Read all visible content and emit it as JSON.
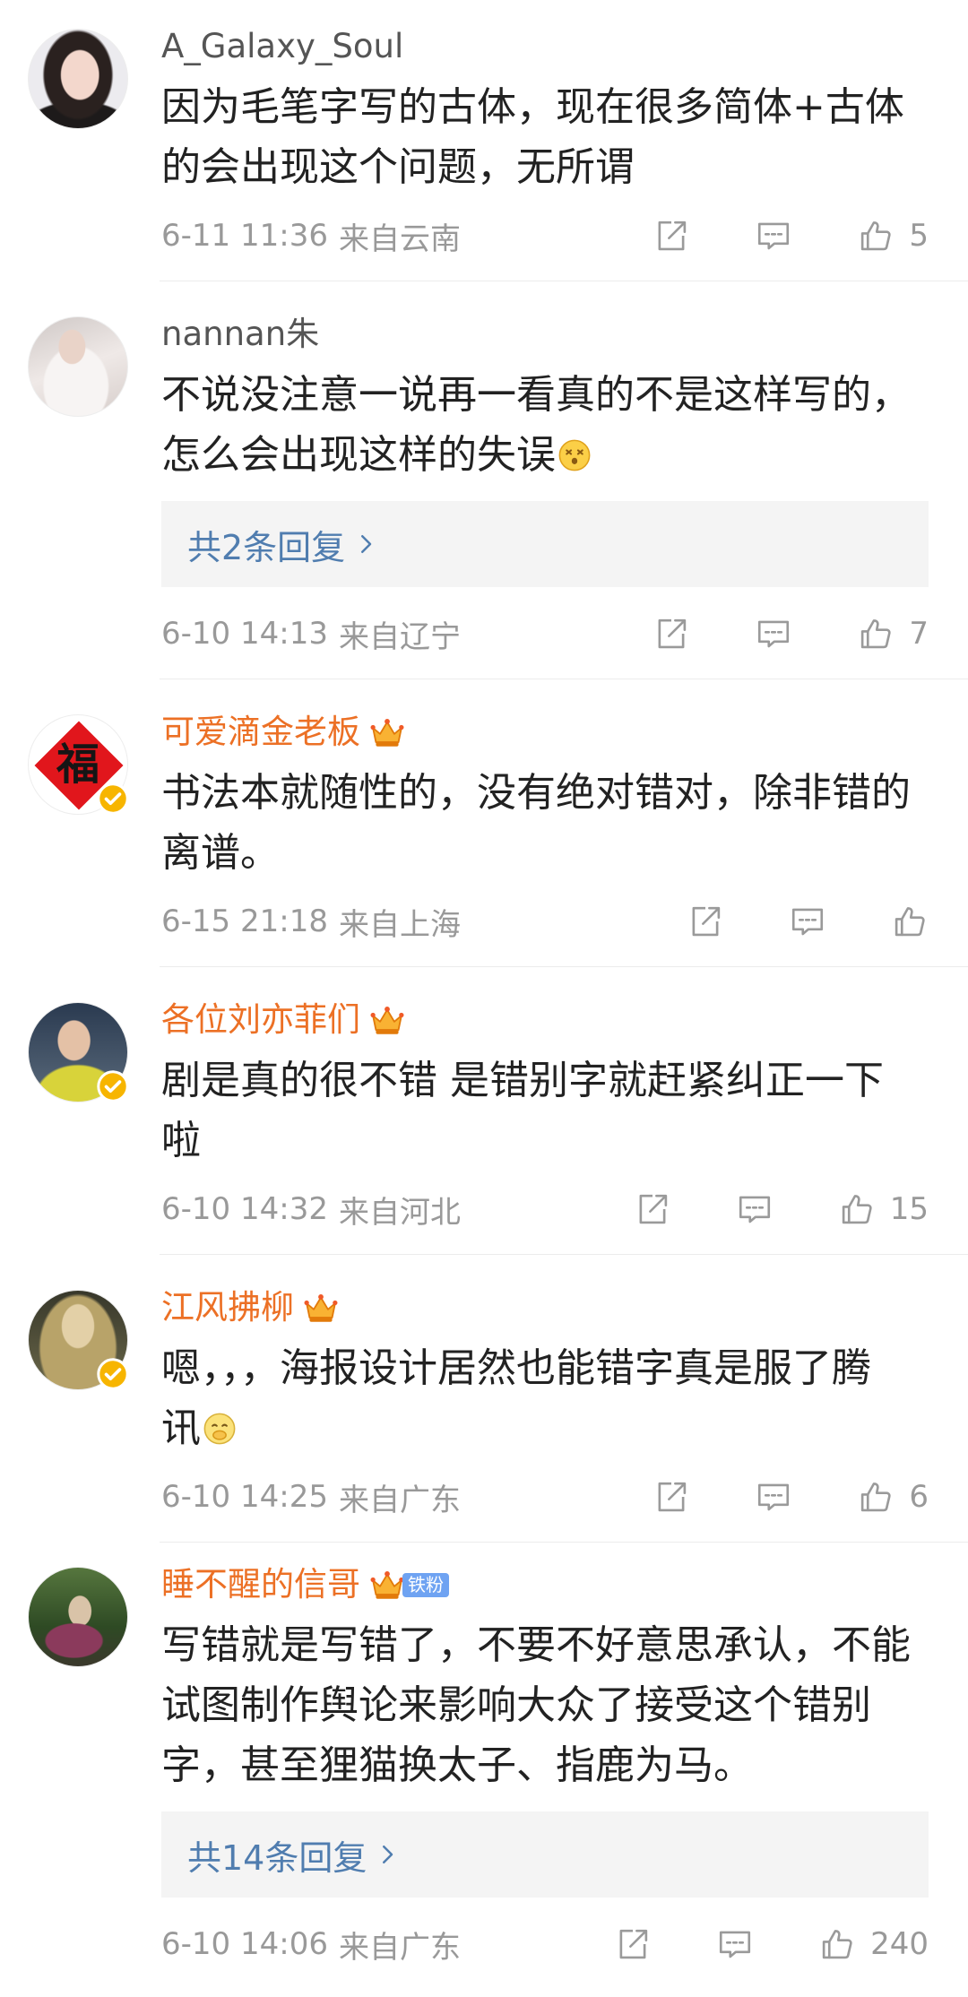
{
  "colors": {
    "username": "#555555",
    "vip_username": "#ec7025",
    "body_text": "#222222",
    "meta_text": "#999999",
    "link": "#507daf",
    "reply_box_bg": "#f4f4f4",
    "divider": "#ececec",
    "verified_badge": "#f7b500",
    "fan_badge": "#6fa3f2"
  },
  "icons": {
    "share": "share-icon",
    "comment": "comment-icon",
    "like": "thumb-up-icon",
    "crown": "vip-crown-icon",
    "verified": "verified-badge-icon",
    "chevron": "chevron-right-icon"
  },
  "comments": [
    {
      "username": "A_Galaxy_Soul",
      "text_lines": [
        "因为毛笔字写的古体，现在很多简体+古体",
        "的会出现这个问题，无所谓"
      ],
      "time": "6-11 11:36",
      "location": "来自云南",
      "likes": "5"
    },
    {
      "username": "nannan朱",
      "text_lines": [
        "不说没注意一说再一看真的不是这样写的，",
        "怎么会出现这样的失误"
      ],
      "emoji": "dizzy-face-emoji",
      "replies": "共2条回复",
      "time": "6-10 14:13",
      "location": "来自辽宁",
      "likes": "7"
    },
    {
      "username": "可爱滴金老板",
      "badge_icon": "vip-crown-icon",
      "verified_icon": "verified-badge-icon",
      "avatar_text": "福",
      "text_lines": [
        "书法本就随性的，没有绝对错对，除非错的",
        "离谱。"
      ],
      "time": "6-15 21:18",
      "location": "来自上海"
    },
    {
      "username": "各位刘亦菲们",
      "badge_icon": "vip-crown-icon",
      "verified_icon": "verified-badge-icon",
      "text_lines": [
        "剧是真的很不错 是错别字就赶紧纠正一下",
        "啦"
      ],
      "time": "6-10 14:32",
      "location": "来自河北",
      "likes": "15"
    },
    {
      "username": "江风拂柳",
      "badge_icon": "vip-crown-icon",
      "verified_icon": "verified-badge-icon",
      "text_lines": [
        "嗯，，，海报设计居然也能错字真是服了腾",
        "讯"
      ],
      "emoji": "hand-over-mouth-face-emoji",
      "time": "6-10 14:25",
      "location": "来自广东",
      "likes": "6"
    },
    {
      "username": "睡不醒的信哥",
      "badge_icon": "vip-crown-icon",
      "fan_badge": "铁粉",
      "text_lines": [
        "写错就是写错了，不要不好意思承认，不能",
        "试图制作舆论来影响大众了接受这个错别",
        "字，甚至狸猫换太子、指鹿为马。"
      ],
      "replies": "共14条回复",
      "time": "6-10 14:06",
      "location": "来自广东",
      "likes": "240"
    }
  ]
}
